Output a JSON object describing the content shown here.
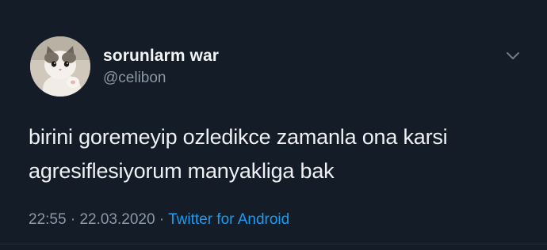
{
  "tweet": {
    "display_name": "sorunlarm war",
    "handle": "@celibon",
    "text_line1": "birini goremeyip ozledikce zamanla ona karsi",
    "text_line2": "agresiflesiyorum manyakliga bak",
    "time": "22:55",
    "separator1": "·",
    "date": "22.03.2020",
    "separator2": "·",
    "source": "Twitter for Android"
  },
  "icons": {
    "avatar": "cat-avatar",
    "menu": "chevron-down-icon"
  },
  "colors": {
    "background": "#15202b",
    "accent": "#1d9bf0",
    "secondary_text": "#8b98a5"
  }
}
